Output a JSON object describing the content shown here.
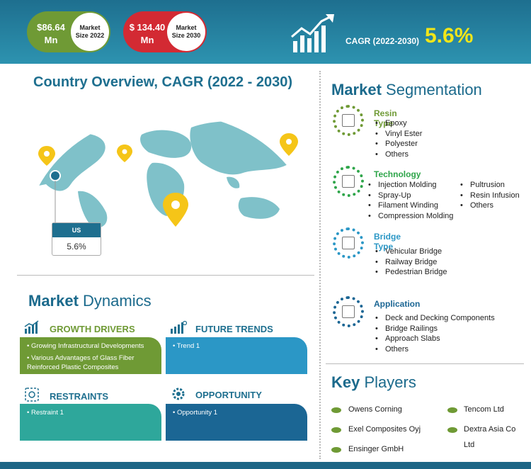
{
  "header": {
    "market_2022_value": "$86.64 Mn",
    "market_2022_label": "Market Size 2022",
    "market_2030_value": "$ 134.40 Mn",
    "market_2030_label": "Market Size 2030",
    "cagr_label": "CAGR (2022-2030)",
    "cagr_value": "5.6%"
  },
  "country_overview": {
    "title": "Country Overview, CAGR (2022 - 2030)",
    "country": "US",
    "value": "5.6%"
  },
  "market_dynamics": {
    "title_bold": "Market",
    "title_rest": " Dynamics",
    "growth_drivers": {
      "title": "GROWTH DRIVERS",
      "items": [
        "Growing Infrastructural Developments",
        "Various Advantages of Glass Fiber Reinforced Plastic Composites"
      ],
      "color": "#6f9a35"
    },
    "future_trends": {
      "title": "FUTURE TRENDS",
      "items": [
        "Trend 1"
      ],
      "color": "#2b97c6"
    },
    "restraints": {
      "title": "RESTRAINTS",
      "items": [
        "Restraint 1"
      ],
      "color": "#2ea79b"
    },
    "opportunity": {
      "title": "OPPORTUNITY",
      "items": [
        "Opportunity 1"
      ],
      "color": "#1b6694"
    }
  },
  "segmentation": {
    "title_bold": "Market",
    "title_rest": " Segmentation",
    "resin_type": {
      "title": "Resin Type",
      "color": "#6f9a35",
      "items": [
        "Epoxy",
        "Vinyl Ester",
        "Polyester",
        "Others"
      ]
    },
    "technology": {
      "title": "Technology",
      "color": "#2ea54a",
      "items_left": [
        "Injection Molding",
        "Spray-Up",
        "Filament Winding",
        "Compression Molding"
      ],
      "items_right": [
        "Pultrusion",
        "Resin Infusion",
        "Others"
      ]
    },
    "bridge_type": {
      "title": "Bridge Type",
      "color": "#2b97c6",
      "items": [
        "Vehicular Bridge",
        "Railway Bridge",
        "Pedestrian Bridge"
      ]
    },
    "application": {
      "title": "Application",
      "color": "#1b6694",
      "items": [
        "Deck and Decking Components",
        "Bridge Railings",
        "Approach Slabs",
        "Others"
      ]
    }
  },
  "key_players": {
    "title_bold": "Key",
    "title_rest": " Players",
    "left": [
      "Owens Corning",
      "Exel Composites Oyj",
      "Ensinger GmbH"
    ],
    "right_1": "Tencom Ltd",
    "right_2a": "Dextra Asia Co",
    "right_2b": "Ltd"
  }
}
